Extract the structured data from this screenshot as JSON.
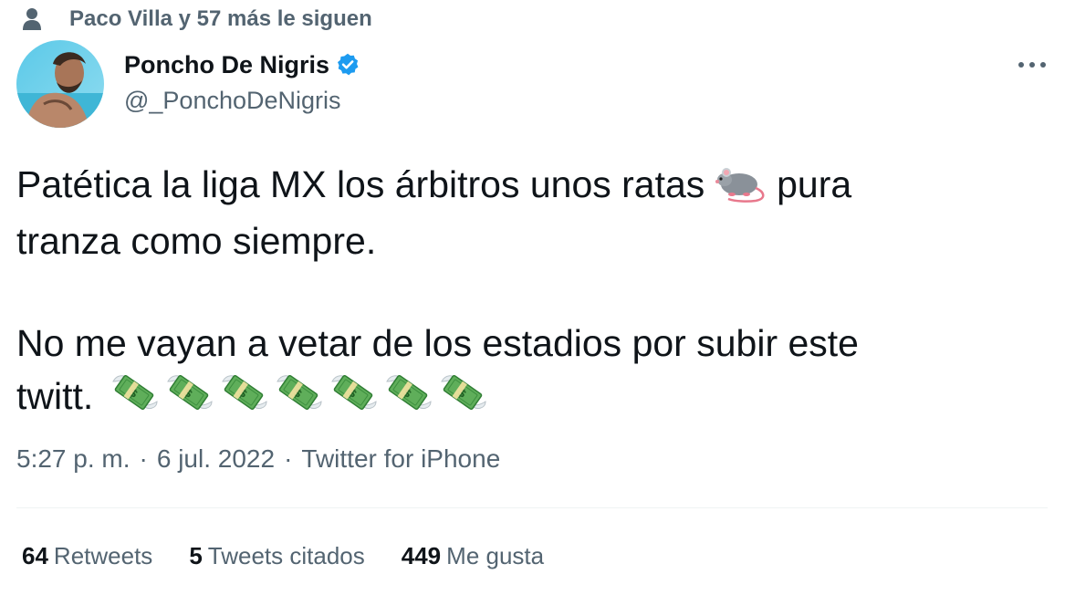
{
  "social_context": {
    "icon": "person-icon",
    "text": "Paco Villa y 57 más le siguen"
  },
  "author": {
    "name": "Poncho De Nigris",
    "handle": "@_PonchoDeNigris",
    "verified": true,
    "verified_icon": "verified-badge-icon",
    "avatar_icon": "avatar"
  },
  "tweet": {
    "line1_text": "Patética la liga MX los árbitros unos ratas",
    "line1_emoji": "rat-emoji",
    "line1_after": "pura",
    "line2_text": "tranza como siempre.",
    "line3_text": "No me vayan a vetar de los estadios por subir este",
    "line4_text": "twitt.",
    "money_emoji": "money-with-wings-emoji",
    "money_emoji_count": 7
  },
  "meta": {
    "time": "5:27 p. m.",
    "separator": "·",
    "date": "6 jul. 2022",
    "source": "Twitter for iPhone"
  },
  "stats": {
    "retweets_count": "64",
    "retweets_label": "Retweets",
    "quotes_count": "5",
    "quotes_label": "Tweets citados",
    "likes_count": "449",
    "likes_label": "Me gusta"
  },
  "colors": {
    "primary_text": "#0f1419",
    "secondary_text": "#536471",
    "verified_blue": "#1d9bf0",
    "divider": "#eff3f4"
  }
}
